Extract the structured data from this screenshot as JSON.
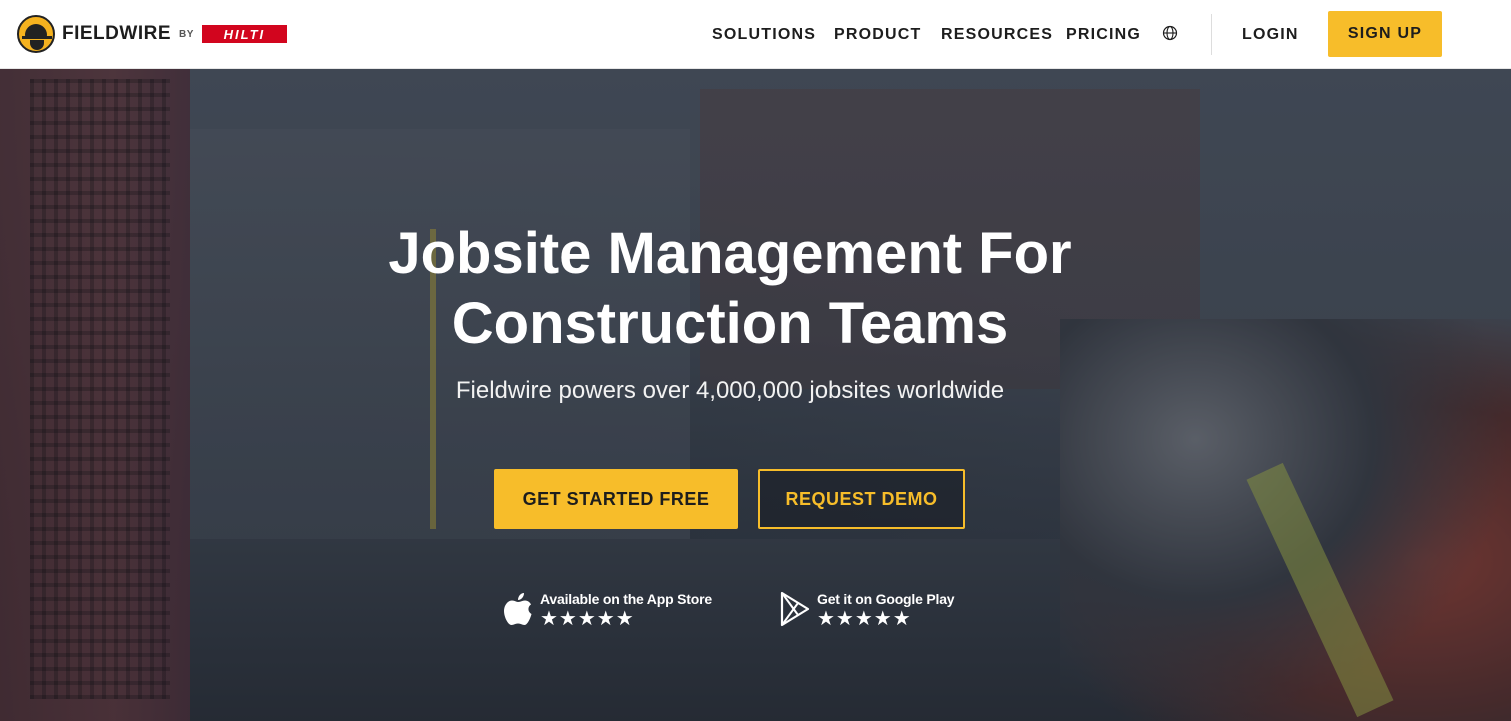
{
  "header": {
    "logo_text": "FIELDWIRE",
    "logo_by": "BY",
    "partner_logo": "HILTI",
    "nav": [
      "SOLUTIONS",
      "PRODUCT",
      "RESOURCES",
      "PRICING"
    ],
    "language_icon": "globe-icon",
    "login_label": "LOGIN",
    "signup_label": "SIGN UP"
  },
  "hero": {
    "title_line1": "Jobsite Management For",
    "title_line2": "Construction Teams",
    "subtitle": "Fieldwire powers over 4,000,000 jobsites worldwide",
    "primary_cta": "GET STARTED FREE",
    "secondary_cta": "REQUEST DEMO",
    "stores": [
      {
        "label": "Available on the App Store",
        "icon": "apple-icon",
        "stars": "★★★★★"
      },
      {
        "label": "Get it on Google Play",
        "icon": "google-play-icon",
        "stars": "★★★★★"
      }
    ]
  },
  "colors": {
    "accent": "#f7bd2a",
    "brand_red": "#d2051e",
    "text_dark": "#1d1d1d"
  }
}
